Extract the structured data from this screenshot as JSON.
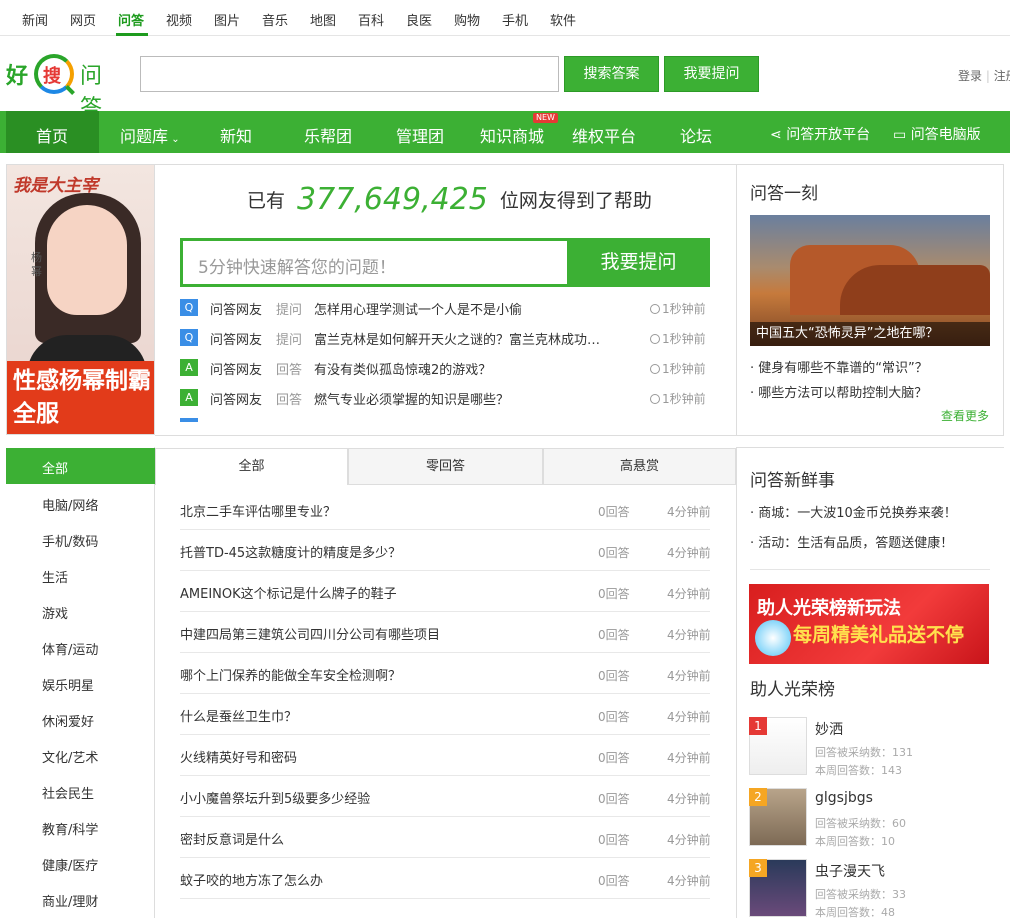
{
  "top_nav": [
    "新闻",
    "网页",
    "问答",
    "视频",
    "图片",
    "音乐",
    "地图",
    "百科",
    "良医",
    "购物",
    "手机",
    "软件"
  ],
  "logo": {
    "hao": "好",
    "sou": "搜",
    "wenda": "问答"
  },
  "search": {
    "search_btn": "搜索答案",
    "ask_btn": "我要提问"
  },
  "login": {
    "login": "登录",
    "sep": "|",
    "register": "注册"
  },
  "main_nav": {
    "home": "首页",
    "items": [
      "问题库",
      "新知",
      "乐帮团",
      "管理团",
      "知识商城",
      "维权平台",
      "论坛"
    ],
    "new_badge": "NEW",
    "right": [
      "问答开放平台",
      "问答电脑版"
    ]
  },
  "colors": {
    "brand_green": "#3cb034",
    "dark_green": "#2a8f23",
    "q_blue": "#3a8ee6"
  },
  "ad_left": {
    "top_text": "我是大主宰",
    "name": "杨幂",
    "band_text": "性感杨幂制霸全服"
  },
  "stats": {
    "prefix": "已有",
    "count": "377,649,425",
    "suffix": "位网友得到了帮助"
  },
  "ask": {
    "placeholder": "5分钟快速解答您的问题！",
    "button": "我要提问"
  },
  "feed": [
    {
      "type": "Q",
      "user": "问答网友",
      "action": "提问",
      "text": "怎样用心理学测试一个人是不是小偷",
      "time": "1秒钟前"
    },
    {
      "type": "Q",
      "user": "问答网友",
      "action": "提问",
      "text": "富兰克林是如何解开天火之谜的？富兰克林成功…",
      "time": "1秒钟前"
    },
    {
      "type": "A",
      "user": "问答网友",
      "action": "回答",
      "text": "有没有类似孤岛惊魂2的游戏？",
      "time": "1秒钟前"
    },
    {
      "type": "A",
      "user": "问答网友",
      "action": "回答",
      "text": "燃气专业必须掌握的知识是哪些？",
      "time": "1秒钟前"
    }
  ],
  "moment": {
    "title": "问答一刻",
    "caption": "中国五大“恐怖灵异”之地在哪？",
    "links": [
      "· 健身有哪些不靠谱的“常识”？",
      "· 哪些方法可以帮助控制大脑？"
    ],
    "more": "查看更多"
  },
  "categories": {
    "all": "全部",
    "items": [
      "电脑/网络",
      "手机/数码",
      "生活",
      "游戏",
      "体育/运动",
      "娱乐明星",
      "休闲爱好",
      "文化/艺术",
      "社会民生",
      "教育/科学",
      "健康/医疗",
      "商业/理财"
    ]
  },
  "tabs": [
    "全部",
    "零回答",
    "高悬赏"
  ],
  "questions": [
    {
      "title": "北京二手车评估哪里专业？",
      "count": "0回答",
      "time": "4分钟前"
    },
    {
      "title": "托普TD-45这款糖度计的精度是多少？",
      "count": "0回答",
      "time": "4分钟前"
    },
    {
      "title": "AMEINOK这个标记是什么牌子的鞋子",
      "count": "0回答",
      "time": "4分钟前"
    },
    {
      "title": "中建四局第三建筑公司四川分公司有哪些项目",
      "count": "0回答",
      "time": "4分钟前"
    },
    {
      "title": "哪个上门保养的能做全车安全检测啊？",
      "count": "0回答",
      "time": "4分钟前"
    },
    {
      "title": "什么是蚕丝卫生巾？",
      "count": "0回答",
      "time": "4分钟前"
    },
    {
      "title": "火线精英好号和密码",
      "count": "0回答",
      "time": "4分钟前"
    },
    {
      "title": "小小魔兽祭坛升到5级要多少经验",
      "count": "0回答",
      "time": "4分钟前"
    },
    {
      "title": "密封反意词是什么",
      "count": "0回答",
      "time": "4分钟前"
    },
    {
      "title": "蚊子咬的地方冻了怎么办",
      "count": "0回答",
      "time": "4分钟前"
    }
  ],
  "news": {
    "title": "问答新鲜事",
    "items": [
      "· 商城：一大波10金币兑换券来袭！",
      "· 活动：生活有品质，答题送健康！"
    ]
  },
  "glory_banner": {
    "line1": "助人光荣榜新玩法",
    "line2": "每周精美礼品送不停"
  },
  "glory": {
    "title": "助人光荣榜",
    "ranks": [
      {
        "no": "1",
        "name": "妙洒",
        "adopted": "回答被采纳数：131",
        "weekly": "本周回答数：143",
        "color": "#e53935"
      },
      {
        "no": "2",
        "name": "glgsjbgs",
        "adopted": "回答被采纳数：60",
        "weekly": "本周回答数：10",
        "color": "#f5a623"
      },
      {
        "no": "3",
        "name": "虫子漫天飞",
        "adopted": "回答被采纳数：33",
        "weekly": "本周回答数：48",
        "color": "#f5a623"
      }
    ]
  }
}
